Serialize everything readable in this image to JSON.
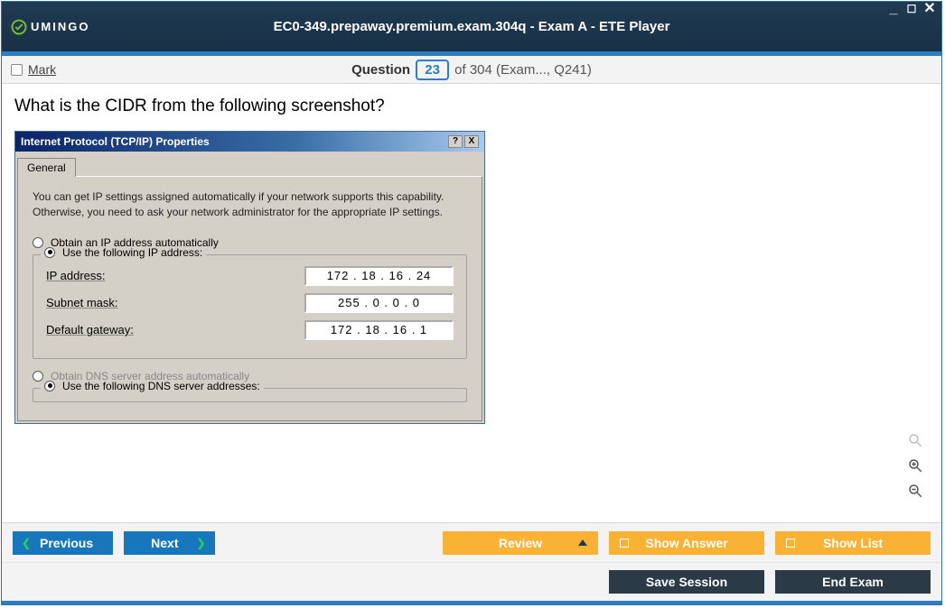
{
  "window": {
    "title": "EC0-349.prepaway.premium.exam.304q - Exam A - ETE Player",
    "brand": "UMINGO"
  },
  "infobar": {
    "mark_label": "Mark",
    "question_label": "Question",
    "question_number": "23",
    "total": "of 304",
    "context": "(Exam..., Q241)"
  },
  "question": {
    "text": "What is the CIDR from the following screenshot?"
  },
  "tcp": {
    "title": "Internet Protocol (TCP/IP) Properties",
    "tab": "General",
    "desc": "You can get IP settings assigned automatically if your network supports this capability. Otherwise, you need to ask your network administrator for the appropriate IP settings.",
    "opt_auto_ip": "Obtain an IP address automatically",
    "opt_use_ip": "Use the following IP address:",
    "label_ip": "IP address:",
    "label_mask": "Subnet mask:",
    "label_gw": "Default gateway:",
    "val_ip": "172 . 18 . 16 . 24",
    "val_mask": "255 .  0  .  0  .  0",
    "val_gw": "172 . 18 . 16 .  1",
    "opt_auto_dns": "Obtain DNS server address automatically",
    "opt_use_dns": "Use the following DNS server addresses:"
  },
  "nav": {
    "prev": "Previous",
    "next": "Next",
    "review": "Review",
    "show_answer": "Show Answer",
    "show_list": "Show List"
  },
  "endbar": {
    "save": "Save Session",
    "end": "End Exam"
  }
}
